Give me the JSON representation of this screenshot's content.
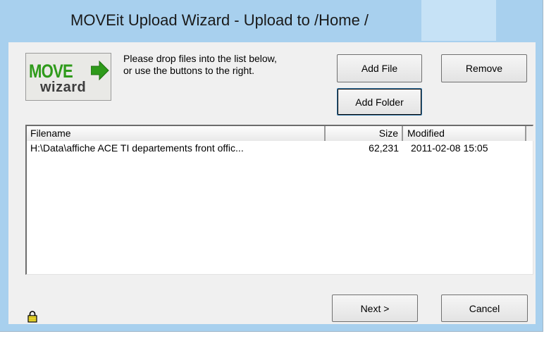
{
  "window": {
    "title": "MOVEit Upload Wizard - Upload to /Home /"
  },
  "logo": {
    "line1": "MOVE",
    "line2": "wizard",
    "brand_green": "#2e9a1a"
  },
  "instructions": {
    "line1": "Please drop files into the list below,",
    "line2": "or use the buttons to the right."
  },
  "buttons": {
    "add_file": "Add File",
    "remove": "Remove",
    "add_folder": "Add Folder",
    "next": "Next >",
    "cancel": "Cancel"
  },
  "file_list": {
    "columns": [
      "Filename",
      "Size",
      "Modified"
    ],
    "rows": [
      {
        "filename": "H:\\Data\\affiche ACE TI departements front offic...",
        "size": "62,231",
        "modified": "2011-02-08  15:05"
      }
    ]
  },
  "icons": {
    "lock": "lock-icon",
    "logo_arrow": "arrow-right-icon"
  }
}
